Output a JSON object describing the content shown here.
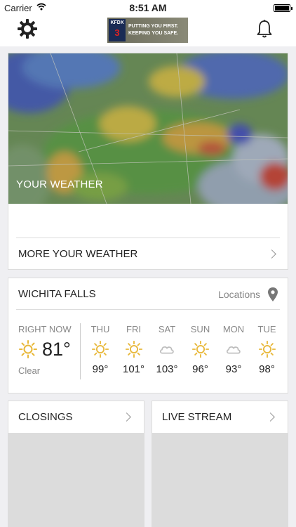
{
  "status_bar": {
    "carrier": "Carrier",
    "time": "8:51 AM"
  },
  "nav": {
    "settings_icon": "gear-icon",
    "notifications_icon": "bell-icon",
    "logo": {
      "station": "KFDX",
      "channel": "3",
      "slogan_line1": "PUTTING YOU FIRST.",
      "slogan_line2": "KEEPING YOU SAFE."
    }
  },
  "weather_card": {
    "radar_label": "YOUR WEATHER",
    "more_label": "MORE YOUR WEATHER"
  },
  "forecast": {
    "city": "WICHITA FALLS",
    "locations_label": "Locations",
    "now": {
      "label": "RIGHT NOW",
      "temp": "81°",
      "condition": "Clear",
      "icon": "sun-icon"
    },
    "days": [
      {
        "name": "THU",
        "temp": "99°",
        "icon": "sun-icon"
      },
      {
        "name": "FRI",
        "temp": "101°",
        "icon": "sun-icon"
      },
      {
        "name": "SAT",
        "temp": "103°",
        "icon": "cloud-icon"
      },
      {
        "name": "SUN",
        "temp": "96°",
        "icon": "sun-icon"
      },
      {
        "name": "MON",
        "temp": "93°",
        "icon": "cloud-icon"
      },
      {
        "name": "TUE",
        "temp": "98°",
        "icon": "sun-icon"
      }
    ]
  },
  "tiles": {
    "closings_label": "CLOSINGS",
    "live_label": "LIVE STREAM"
  },
  "colors": {
    "sun": "#e8b83a",
    "cloud": "#bdbdbd",
    "background": "#efeff2"
  }
}
